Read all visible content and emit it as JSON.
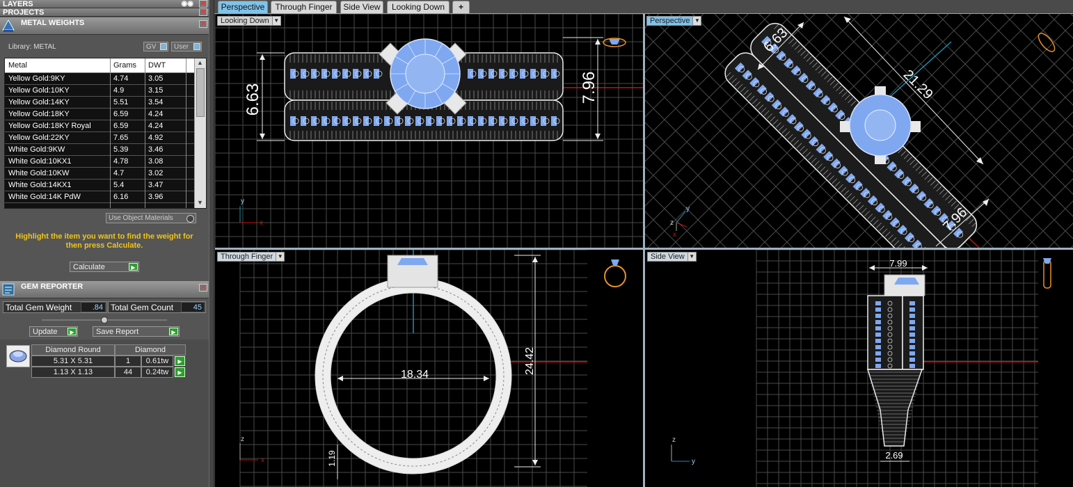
{
  "panels": {
    "layers_title": "LAYERS",
    "projects_title": "PROJECTS",
    "metal_weights_title": "METAL WEIGHTS",
    "gem_reporter_title": "GEM REPORTER"
  },
  "metal_weights": {
    "library_label": "Library: METAL",
    "gv_label": "GV",
    "user_label": "User",
    "columns": [
      "Metal",
      "Grams",
      "DWT"
    ],
    "rows": [
      {
        "metal": "Yellow Gold:9KY",
        "grams": "4.74",
        "dwt": "3.05"
      },
      {
        "metal": "Yellow Gold:10KY",
        "grams": "4.9",
        "dwt": "3.15"
      },
      {
        "metal": "Yellow Gold:14KY",
        "grams": "5.51",
        "dwt": "3.54"
      },
      {
        "metal": "Yellow Gold:18KY",
        "grams": "6.59",
        "dwt": "4.24"
      },
      {
        "metal": "Yellow Gold:18KY Royal",
        "grams": "6.59",
        "dwt": "4.24"
      },
      {
        "metal": "Yellow Gold:22KY",
        "grams": "7.65",
        "dwt": "4.92"
      },
      {
        "metal": "White Gold:9KW",
        "grams": "5.39",
        "dwt": "3.46"
      },
      {
        "metal": "White Gold:10KX1",
        "grams": "4.78",
        "dwt": "3.08"
      },
      {
        "metal": "White Gold:10KW",
        "grams": "4.7",
        "dwt": "3.02"
      },
      {
        "metal": "White Gold:14KX1",
        "grams": "5.4",
        "dwt": "3.47"
      },
      {
        "metal": "White Gold:14K PdW",
        "grams": "6.16",
        "dwt": "3.96"
      }
    ],
    "use_object_materials": "Use Object Materials",
    "hint": "Highlight the item you want to find the weight for then press Calculate.",
    "calculate_label": "Calculate"
  },
  "gem_reporter": {
    "total_gem_weight_label": "Total Gem Weight",
    "total_gem_weight": ".84",
    "total_gem_count_label": "Total Gem Count",
    "total_gem_count": "45",
    "update_label": "Update",
    "save_report_label": "Save Report",
    "header_shape": "Diamond Round",
    "header_type": "Diamond",
    "gems": [
      {
        "size": "5.31 X 5.31",
        "count": "1",
        "weight": "0.61tw"
      },
      {
        "size": "1.13 X 1.13",
        "count": "44",
        "weight": "0.24tw"
      }
    ]
  },
  "tabs": [
    "Perspective",
    "Through Finger",
    "Side View",
    "Looking Down",
    "+"
  ],
  "viewports": {
    "looking_down": {
      "label": "Looking Down",
      "dim_left": "6.63",
      "dim_right": "7.96",
      "axis_y": "y",
      "axis_x": "x"
    },
    "perspective": {
      "label": "Perspective",
      "dim_a": "6.63",
      "dim_b": "21.29",
      "dim_c": "7.96",
      "axis_y": "y",
      "axis_z": "z",
      "axis_x": "x"
    },
    "through_finger": {
      "label": "Through Finger",
      "dim_width": "18.34",
      "dim_height": "24.42",
      "dim_thick": "1.19",
      "axis_z": "z",
      "axis_x": "x"
    },
    "side_view": {
      "label": "Side View",
      "dim_top": "7.99",
      "dim_bottom": "2.69",
      "axis_z": "z",
      "axis_y": "y"
    }
  },
  "colors": {
    "active_tab": "#7fc3ea",
    "hint_text": "#f0c419",
    "gem_blue": "#7fa8f0",
    "axis_red": "#cc1111",
    "axis_teal": "#1d8fb0"
  }
}
